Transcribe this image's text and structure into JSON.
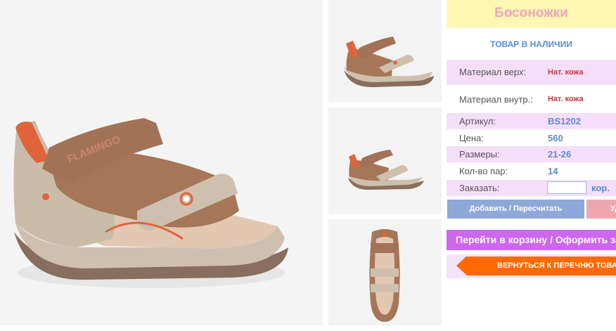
{
  "product": {
    "title": "Босоножки",
    "stock_status": "ТОВАР В НАЛИЧИИ",
    "brand_mark": "FLAMINGO"
  },
  "specs": {
    "material_top_label": "Материал верх:",
    "material_top_value": "Нат. кожа",
    "material_inner_label": "Материал внутр.:",
    "material_inner_value": "Нат. кожа",
    "article_label": "Артикул:",
    "article_value": "BS1202",
    "price_label": "Цена:",
    "price_value": "560",
    "sizes_label": "Размеры:",
    "sizes_value": "21-26",
    "pairs_label": "Кол-во пар:",
    "pairs_value": "14",
    "order_label": "Заказать:",
    "order_qty_value": "",
    "order_unit": "кор."
  },
  "actions": {
    "recalc_label": "Добавить / Пересчитать",
    "delete_label": "Удалить",
    "cart_label": "Перейти в корзину / Оформить заказ",
    "back_label": "ВЕРНУТЬСЯ К ПЕРЕЧНЮ ТОВАРОВ"
  },
  "colors": {
    "title_bg": "#fdf7b4",
    "title_text": "#f4a3b9",
    "accent_blue": "#5b8cd3",
    "value_red": "#c2383e",
    "row_pink": "#f5defa",
    "cart_purple": "#cd67ef",
    "back_orange": "#ff6a00"
  }
}
